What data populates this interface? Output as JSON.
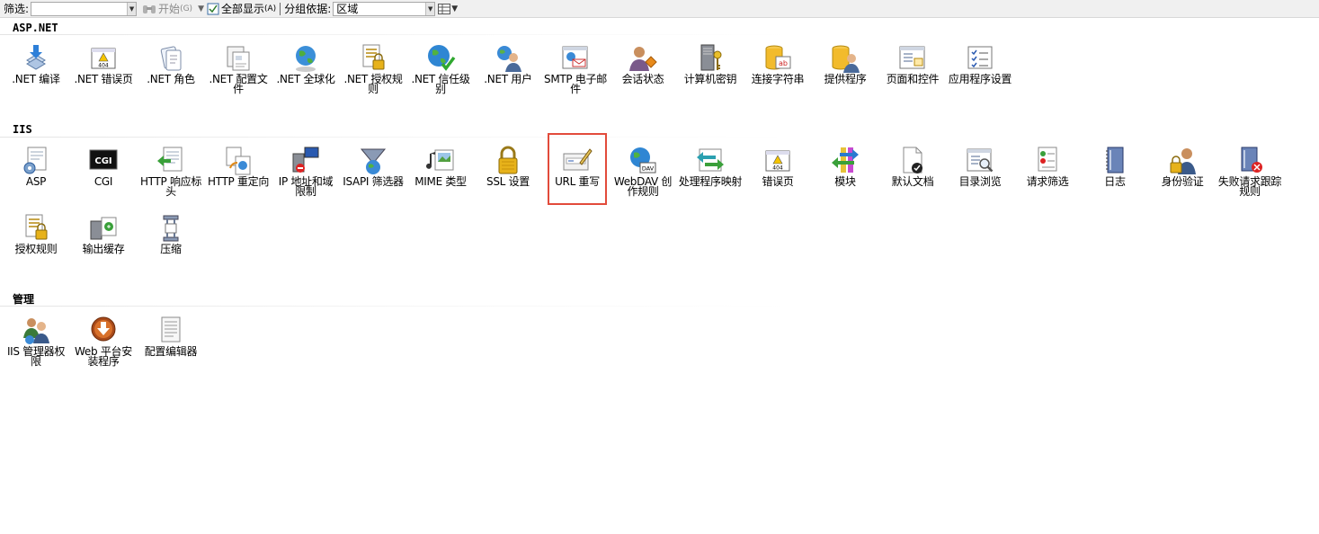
{
  "toolbar": {
    "filter_label": "筛选:",
    "filter_value": "",
    "start_label": "开始",
    "start_shortcut": "(G)",
    "show_all_label": "全部显示",
    "show_all_shortcut": "(A)",
    "group_by_label": "分组依据:",
    "group_by_value": "区域"
  },
  "sections": [
    {
      "title": "ASP.NET",
      "items": [
        {
          "label": ".NET 编译",
          "icon": "dotnet-compile-icon"
        },
        {
          "label": ".NET 错误页",
          "icon": "dotnet-error-page-icon"
        },
        {
          "label": ".NET 角色",
          "icon": "dotnet-roles-icon"
        },
        {
          "label": ".NET 配置文件",
          "icon": "dotnet-profile-icon"
        },
        {
          "label": ".NET 全球化",
          "icon": "dotnet-globalization-icon"
        },
        {
          "label": ".NET 授权规则",
          "icon": "dotnet-authorization-icon"
        },
        {
          "label": ".NET 信任级别",
          "icon": "dotnet-trust-level-icon"
        },
        {
          "label": ".NET 用户",
          "icon": "dotnet-users-icon"
        },
        {
          "label": "SMTP 电子邮件",
          "icon": "smtp-email-icon"
        },
        {
          "label": "会话状态",
          "icon": "session-state-icon"
        },
        {
          "label": "计算机密钥",
          "icon": "machine-key-icon"
        },
        {
          "label": "连接字符串",
          "icon": "connection-strings-icon"
        },
        {
          "label": "提供程序",
          "icon": "providers-icon"
        },
        {
          "label": "页面和控件",
          "icon": "pages-controls-icon"
        },
        {
          "label": "应用程序设置",
          "icon": "app-settings-icon"
        }
      ]
    },
    {
      "title": "IIS",
      "items": [
        {
          "label": "ASP",
          "icon": "asp-icon"
        },
        {
          "label": "CGI",
          "icon": "cgi-icon"
        },
        {
          "label": "HTTP 响应标头",
          "icon": "http-response-headers-icon"
        },
        {
          "label": "HTTP 重定向",
          "icon": "http-redirect-icon"
        },
        {
          "label": "IP 地址和域限制",
          "icon": "ip-domain-restrictions-icon"
        },
        {
          "label": "ISAPI 筛选器",
          "icon": "isapi-filters-icon"
        },
        {
          "label": "MIME 类型",
          "icon": "mime-types-icon"
        },
        {
          "label": "SSL 设置",
          "icon": "ssl-settings-icon"
        },
        {
          "label": "URL 重写",
          "icon": "url-rewrite-icon"
        },
        {
          "label": "WebDAV 创作规则",
          "icon": "webdav-authoring-icon"
        },
        {
          "label": "处理程序映射",
          "icon": "handler-mappings-icon"
        },
        {
          "label": "错误页",
          "icon": "error-pages-icon"
        },
        {
          "label": "模块",
          "icon": "modules-icon"
        },
        {
          "label": "默认文档",
          "icon": "default-document-icon"
        },
        {
          "label": "目录浏览",
          "icon": "directory-browsing-icon"
        },
        {
          "label": "请求筛选",
          "icon": "request-filtering-icon"
        },
        {
          "label": "日志",
          "icon": "logging-icon"
        },
        {
          "label": "身份验证",
          "icon": "authentication-icon"
        },
        {
          "label": "失败请求跟踪规则",
          "icon": "failed-request-tracing-icon"
        },
        {
          "label": "授权规则",
          "icon": "authorization-rules-icon"
        },
        {
          "label": "输出缓存",
          "icon": "output-caching-icon"
        },
        {
          "label": "压缩",
          "icon": "compression-icon"
        }
      ]
    },
    {
      "title": "管理",
      "items": [
        {
          "label": "IIS 管理器权限",
          "icon": "iis-manager-permissions-icon"
        },
        {
          "label": "Web 平台安装程序",
          "icon": "web-platform-installer-icon"
        },
        {
          "label": "配置编辑器",
          "icon": "configuration-editor-icon"
        }
      ]
    }
  ],
  "colors": {
    "highlight": "#e24b3b"
  }
}
